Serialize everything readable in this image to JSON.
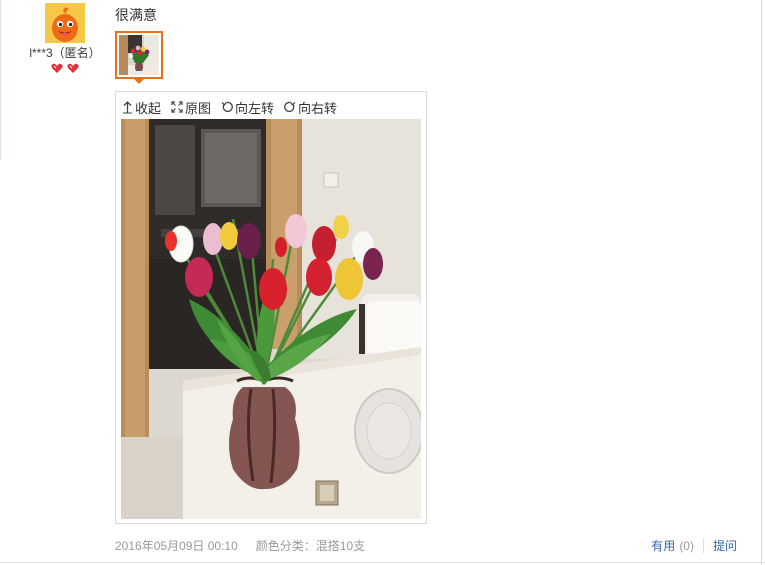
{
  "reviewer": {
    "avatar": "orange-mascot-avatar",
    "name": "l***3（匿名）",
    "level_badge": "red-heart-badge"
  },
  "review": {
    "text": "很满意",
    "thumbnail_alt": "tulip-bouquet-photo"
  },
  "viewer": {
    "toolbar": [
      {
        "icon": "collapse-icon",
        "label": "收起"
      },
      {
        "icon": "expand-icon",
        "label": "原图"
      },
      {
        "icon": "rotate-left-icon",
        "label": "向左转"
      },
      {
        "icon": "rotate-right-icon",
        "label": "向右转"
      }
    ],
    "photo": "tulip-bouquet-photo"
  },
  "meta": {
    "date": "2016年05月09日 00:10",
    "sku": "颜色分类：混搭10支"
  },
  "actions": {
    "useful_label": "有用",
    "useful_count": "(0)",
    "ask_label": "提问"
  },
  "colors": {
    "accent_orange": "#e4741a",
    "link_blue": "#3366aa",
    "meta_gray": "#999999"
  }
}
